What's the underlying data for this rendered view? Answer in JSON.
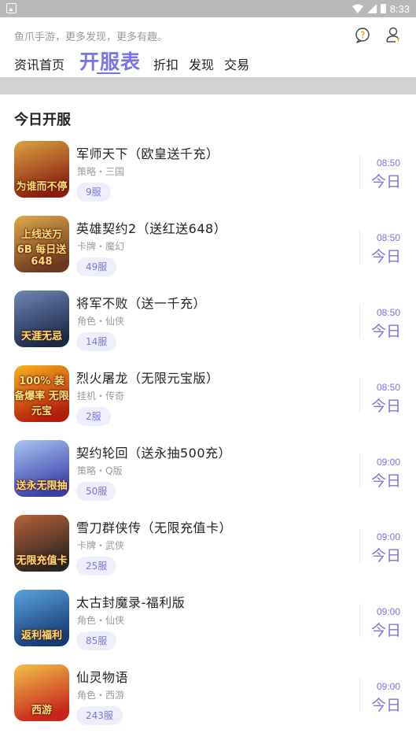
{
  "status_bar": {
    "time": "8:33"
  },
  "header": {
    "slogan": "鱼爪手游，更多发现，更多有趣。",
    "tabs": [
      {
        "label": "资讯首页",
        "active": false
      },
      {
        "label": "开服表",
        "active": true
      },
      {
        "label": "折扣",
        "active": false
      },
      {
        "label": "发现",
        "active": false
      },
      {
        "label": "交易",
        "active": false
      }
    ],
    "icons": [
      "message-icon",
      "user-icon"
    ]
  },
  "colors": {
    "accent": "#7b73e6",
    "badge_bg": "#efeffb",
    "band": "#d2d2d2"
  },
  "section_title": "今日开服",
  "games": [
    {
      "name": "军师天下（欧皇送千充）",
      "tags": "策略・三国",
      "server": "9服",
      "time": "08:50",
      "day": "今日",
      "thumb_text": "为谁而不停",
      "thumb_colors": [
        "#8a1d10",
        "#d9a441"
      ]
    },
    {
      "name": "英雄契约2（送红送648）",
      "tags": "卡牌・魔幻",
      "server": "49服",
      "time": "08:50",
      "day": "今日",
      "thumb_text": "上线送万6B 每日送648",
      "thumb_colors": [
        "#6b3a1e",
        "#e0a84a"
      ]
    },
    {
      "name": "将军不败（送一千充）",
      "tags": "角色・仙侠",
      "server": "14服",
      "time": "08:50",
      "day": "今日",
      "thumb_text": "天涯无忌",
      "thumb_colors": [
        "#1c2a4a",
        "#6f86b5"
      ]
    },
    {
      "name": "烈火屠龙（无限元宝版）",
      "tags": "挂机・传奇",
      "server": "2服",
      "time": "08:50",
      "day": "今日",
      "thumb_text": "100% 装备爆率 无限元宝",
      "thumb_colors": [
        "#b31b0d",
        "#f6b21d"
      ]
    },
    {
      "name": "契约轮回（送永抽500充）",
      "tags": "策略・Q版",
      "server": "50服",
      "time": "09:00",
      "day": "今日",
      "thumb_text": "送永无限抽",
      "thumb_colors": [
        "#3a3fa8",
        "#a9c6f2"
      ]
    },
    {
      "name": "雪刀群侠传（无限充值卡）",
      "tags": "卡牌・武侠",
      "server": "25服",
      "time": "09:00",
      "day": "今日",
      "thumb_text": "无限充值卡",
      "thumb_colors": [
        "#2a2520",
        "#b9623a"
      ]
    },
    {
      "name": "太古封魔录-福利版",
      "tags": "角色・仙侠",
      "server": "85服",
      "time": "09:00",
      "day": "今日",
      "thumb_text": "返利福利",
      "thumb_colors": [
        "#173a74",
        "#5aa3de"
      ]
    },
    {
      "name": "仙灵物语",
      "tags": "角色・西游",
      "server": "243服",
      "time": "09:00",
      "day": "今日",
      "thumb_text": "西游",
      "thumb_colors": [
        "#c7241b",
        "#f2c14a"
      ]
    }
  ]
}
